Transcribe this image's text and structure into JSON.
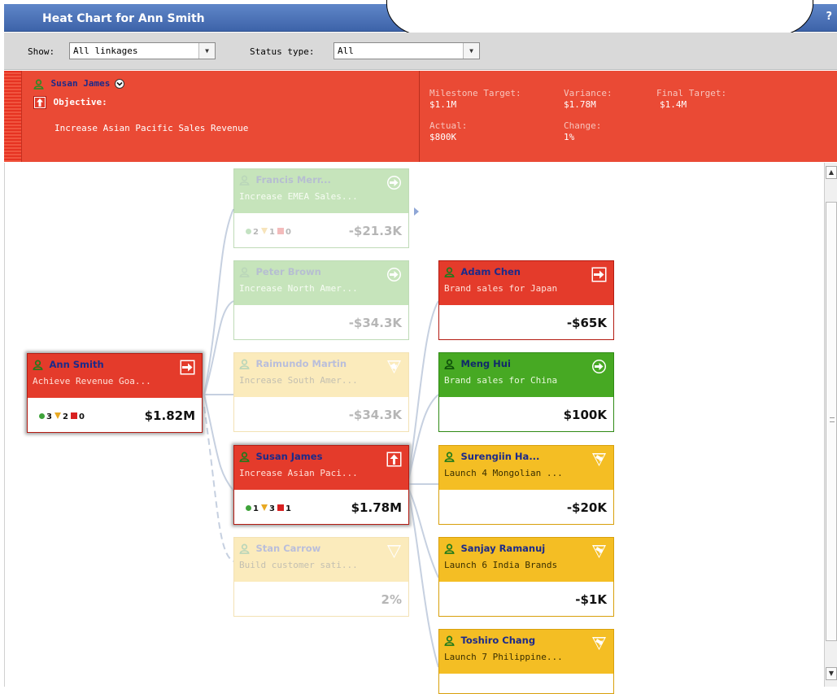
{
  "window": {
    "title": "Heat Chart for Ann Smith",
    "help": "?"
  },
  "filters": {
    "show_label": "Show:",
    "show_value": "All linkages",
    "status_label": "Status type:",
    "status_value": "All"
  },
  "objective": {
    "owner": "Susan James",
    "objective_label": "Objective:",
    "description": "Increase Asian Pacific Sales Revenue",
    "metrics": {
      "milestone_target_label": "Milestone Target:",
      "milestone_target": "$1.1M",
      "variance_label": "Variance:",
      "variance": "$1.78M",
      "final_target_label": "Final Target:",
      "final_target": "$1.4M",
      "actual_label": "Actual:",
      "actual": "$800K",
      "change_label": "Change:",
      "change": "1%"
    }
  },
  "colors": {
    "red": "#e43b2b",
    "green": "#47a923",
    "yellow": "#f4be24",
    "title_blue": "#4a72b8"
  },
  "cards": {
    "ann": {
      "name": "Ann Smith",
      "desc": "Achieve Revenue Goa...",
      "green": "3",
      "yellow": "2",
      "red": "0",
      "value": "$1.82M"
    },
    "francis": {
      "name": "Francis Merr...",
      "desc": "Increase EMEA Sales...",
      "green": "2",
      "yellow": "1",
      "red": "0",
      "value": "-$21.3K"
    },
    "peter": {
      "name": "Peter Brown",
      "desc": "Increase North Amer...",
      "value": "-$34.3K"
    },
    "raimundo": {
      "name": "Raimundo Martin",
      "desc": "Increase South Amer...",
      "value": "-$34.3K"
    },
    "susan": {
      "name": "Susan James",
      "desc": "Increase Asian Paci...",
      "green": "1",
      "yellow": "3",
      "red": "1",
      "value": "$1.78M"
    },
    "stan": {
      "name": "Stan Carrow",
      "desc": "Build customer sati...",
      "value": "2%"
    },
    "adam": {
      "name": "Adam Chen",
      "desc": "Brand sales for Japan",
      "value": "-$65K"
    },
    "meng": {
      "name": "Meng Hui",
      "desc": "Brand sales for China",
      "value": "$100K"
    },
    "surengiin": {
      "name": "Surengiin Ha...",
      "desc": "Launch 4 Mongolian ...",
      "value": "-$20K"
    },
    "sanjay": {
      "name": "Sanjay Ramanuj",
      "desc": "Launch 6 India Brands",
      "value": "-$1K"
    },
    "toshiro": {
      "name": "Toshiro Chang",
      "desc": "Launch 7 Philippine..."
    }
  }
}
